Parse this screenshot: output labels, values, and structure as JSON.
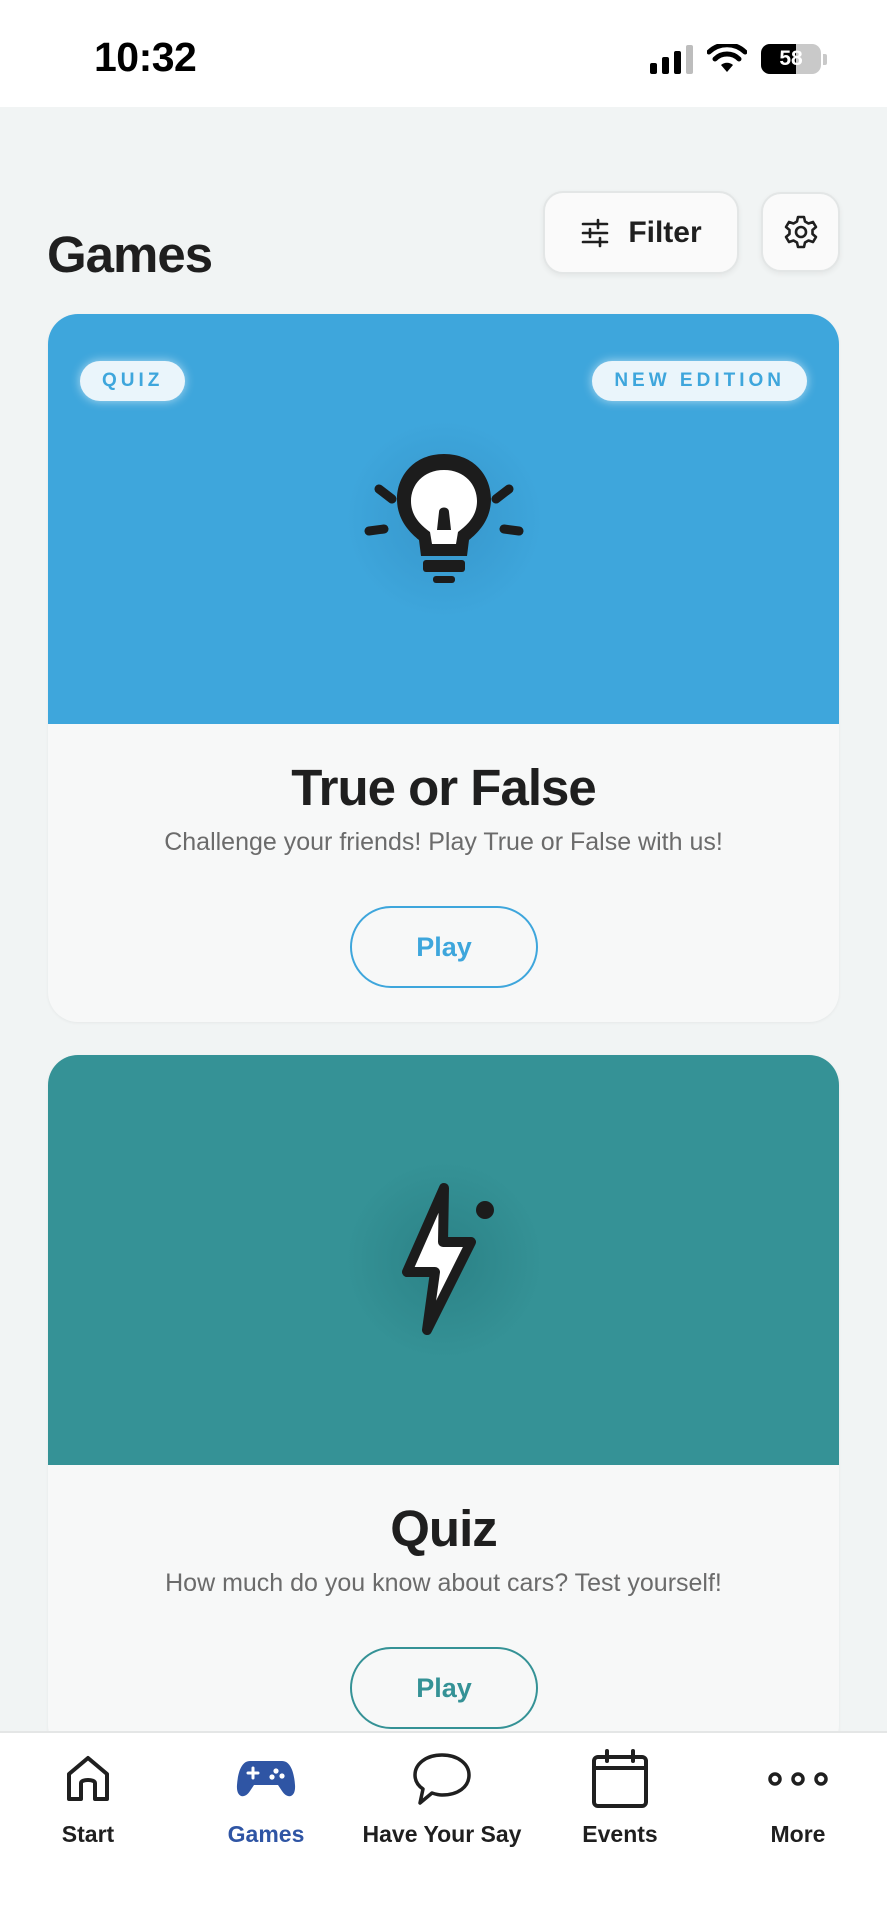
{
  "status_bar": {
    "time": "10:32",
    "battery": "58",
    "battery_level": 0.58
  },
  "header": {
    "title": "Games",
    "filter_label": "Filter"
  },
  "cards": [
    {
      "badge_left": "QUIZ",
      "badge_right": "NEW EDITION",
      "title": "True or False",
      "description": "Challenge your friends! Play True or False with us!",
      "play_label": "Play",
      "icon": "lightbulb-icon",
      "color": "#3ea6dc"
    },
    {
      "title": "Quiz",
      "description": "How much do you know about cars? Test yourself!",
      "play_label": "Play",
      "icon": "lightning-icon",
      "color": "#359296"
    }
  ],
  "tab_bar": {
    "active": "Games",
    "active_color": "#2f55a4",
    "items": [
      {
        "label": "Start",
        "icon": "home-icon"
      },
      {
        "label": "Games",
        "icon": "gamepad-icon"
      },
      {
        "label": "Have Your Say",
        "icon": "speech-bubble-icon"
      },
      {
        "label": "Events",
        "icon": "calendar-icon"
      },
      {
        "label": "More",
        "icon": "more-dots-icon"
      }
    ]
  }
}
